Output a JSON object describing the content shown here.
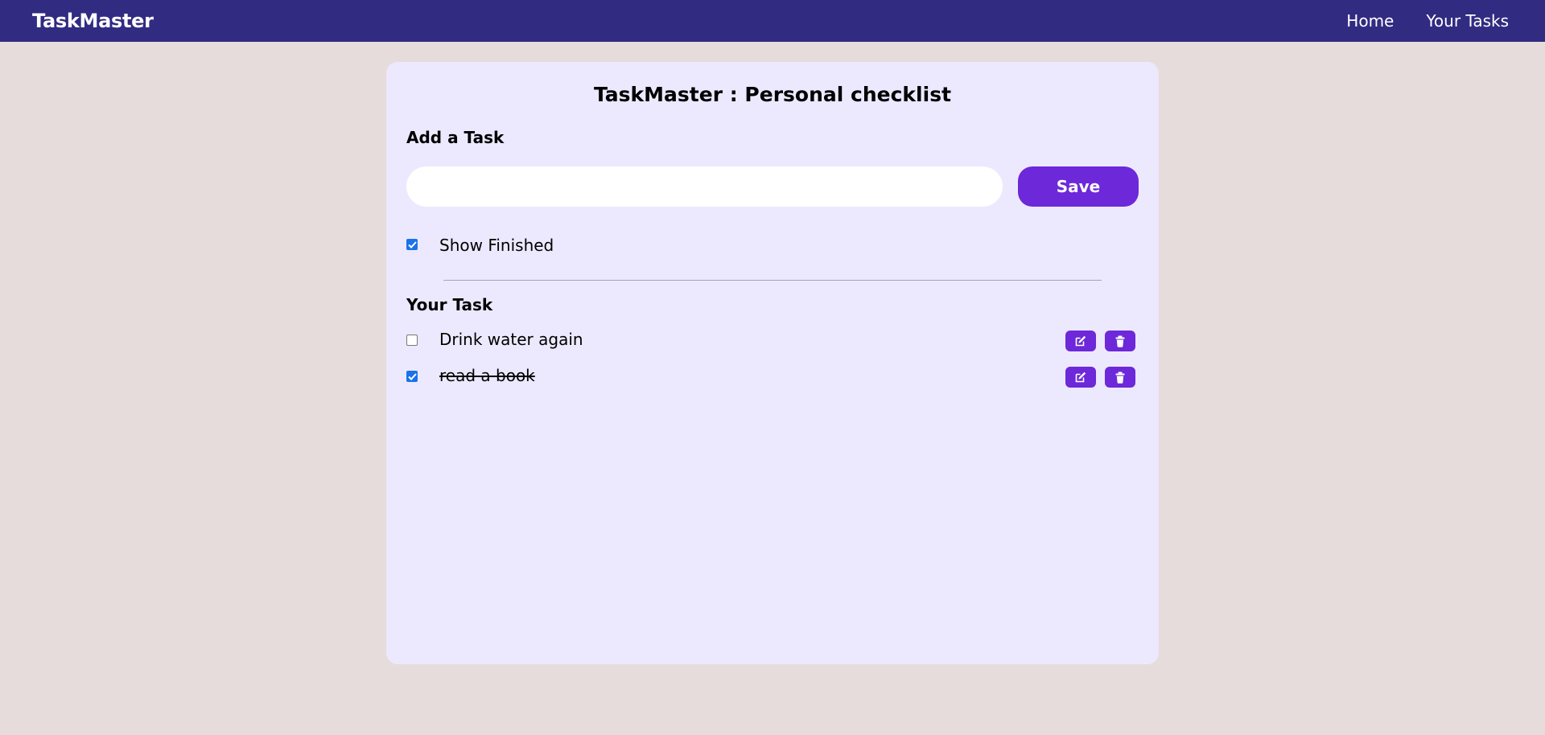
{
  "navbar": {
    "brand": "TaskMaster",
    "links": [
      "Home",
      "Your Tasks"
    ]
  },
  "main": {
    "title": "TaskMaster : Personal checklist",
    "add_section_title": "Add a Task",
    "input_value": "",
    "save_label": "Save",
    "show_finished": {
      "label": "Show Finished",
      "checked": true
    },
    "list_title": "Your Task",
    "tasks": [
      {
        "text": "Drink water again",
        "finished": false
      },
      {
        "text": "read a book",
        "finished": true
      }
    ]
  },
  "icons": {
    "edit": "edit-icon",
    "delete": "trash-icon"
  },
  "colors": {
    "navbar": "#312b82",
    "background": "#e6dcdb",
    "card": "#ece9fe",
    "accent": "#6d28d9",
    "checkbox": "#1a73e8"
  }
}
